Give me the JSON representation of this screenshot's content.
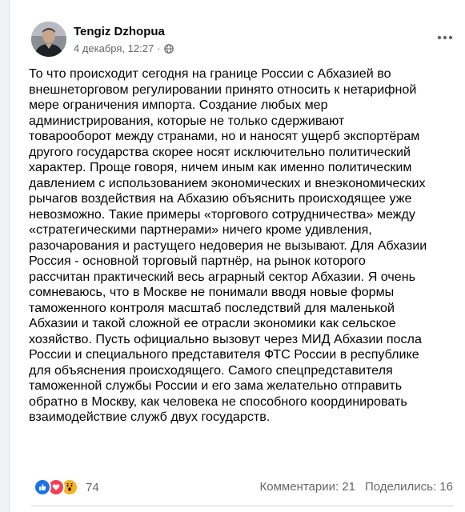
{
  "post": {
    "author": "Tengiz Dzhopua",
    "timestamp": "4 декабря, 12:27",
    "separator": "·",
    "privacy_icon": "globe-icon",
    "more_icon": "more-horizontal-icon",
    "text": "То что происходит сегодня на границе России с Абхазией во\nвнешнеторговом регулировании принято относить к  нетарифной\nмере ограничения импорта. Создание любых мер\nадминистрирования, которые не только сдерживают\nтоварооборот между странами, но и наносят ущерб экспортёрам\nдругого государства скорее носят исключительно политический\nхарактер. Проще говоря, ничем иным как именно политическим\nдавлением с использованием экономических и внеэкономических\nрычагов воздействия на Абхазию объяснить происходящее уже\nневозможно. Такие примеры «торгового сотрудничества» между\n«стратегическими партнерами» ничего кроме удивления,\nразочарования и растущего недоверия не вызывают. Для Абхазии\nРоссия - основной торговый партнёр, на рынок которого\nрассчитан практический весь аграрный сектор Абхазии. Я очень\nсомневаюсь, что в Москве не понимали вводя новые формы\nтаможенного контроля масштаб последствий для маленькой\nАбхазии и такой сложной ее отрасли экономики как сельское\nхозяйство. Пусть официально вызовут через МИД Абхазии посла\nРоссии и специального представителя ФТС России в республике\nдля объяснения происходящего. Самого спецпредставителя\nтаможенной службы России и его зама желательно отправить\nобратно в Москву, как человека не способного координировать\nвзаимодействие служб двух государств."
  },
  "reactions": {
    "icons": [
      "like-icon",
      "love-icon",
      "wow-icon"
    ],
    "count": "74"
  },
  "stats": {
    "comments": "Комментарии: 21",
    "shares": "Поделились: 16"
  },
  "colors": {
    "like": "#1b74e4",
    "love": "#f33e58",
    "wow": "#f7b125",
    "secondary_text": "#65676b"
  }
}
